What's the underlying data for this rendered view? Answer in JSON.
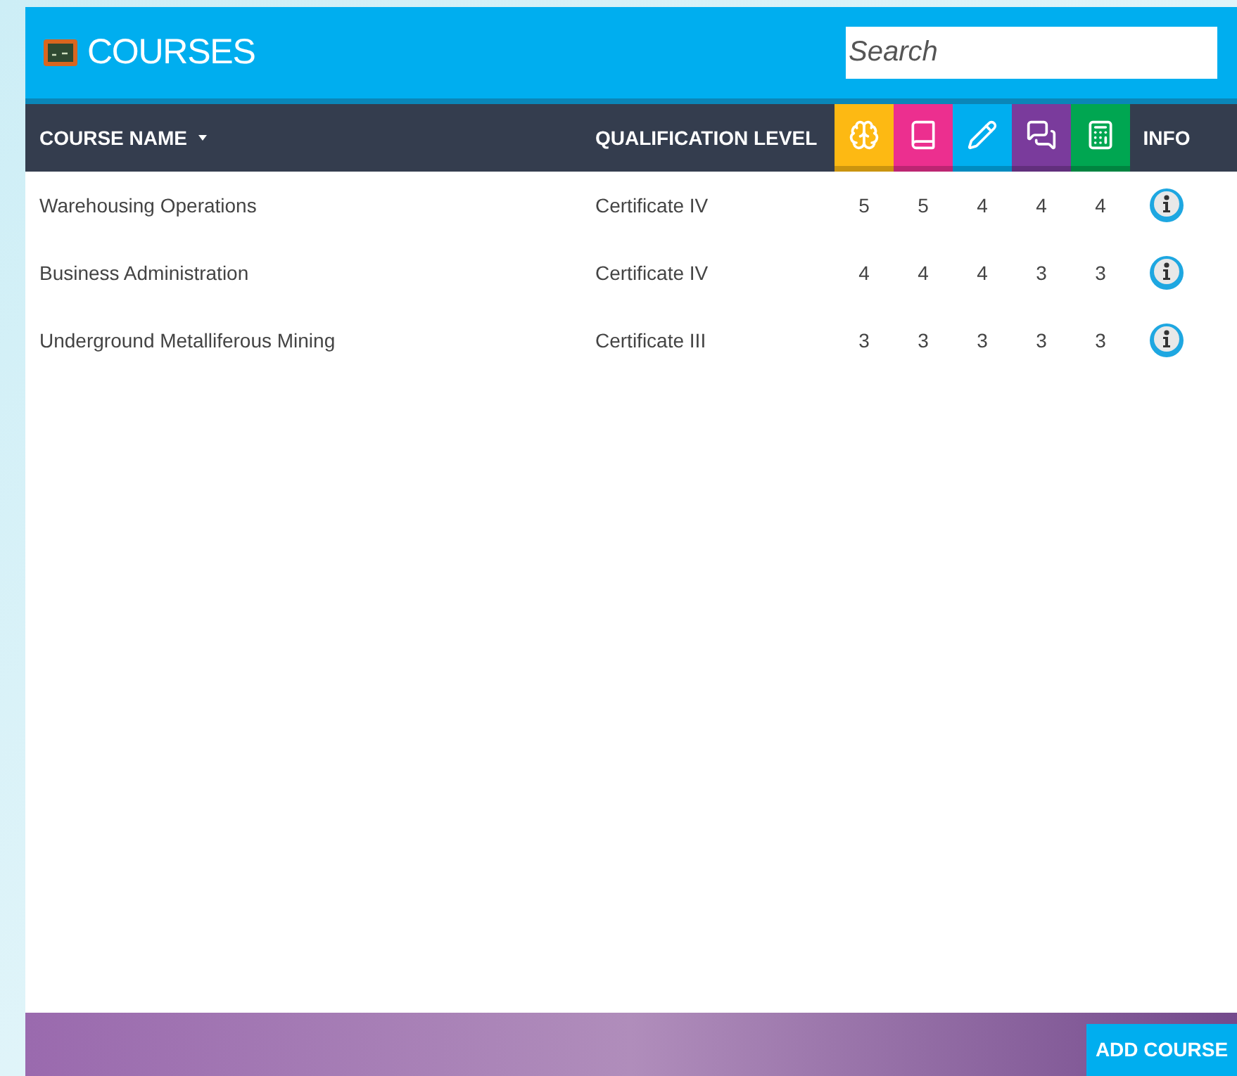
{
  "header": {
    "title": "COURSES",
    "search": {
      "placeholder": "Search"
    }
  },
  "table": {
    "columns": [
      {
        "label": "COURSE NAME",
        "sorted": true
      },
      {
        "label": "QUALIFICATION LEVEL",
        "sorted": false
      }
    ],
    "skill_columns": [
      {
        "color": "#fdb913"
      },
      {
        "color": "#ec2f8f"
      },
      {
        "color": "#00aeef"
      },
      {
        "color": "#7a3b9c"
      },
      {
        "color": "#00a651"
      }
    ],
    "info_column": "INFO",
    "rows": [
      {
        "name": "Warehousing Operations",
        "level": "Certificate IV",
        "scores": [
          "5",
          "5",
          "4",
          "4",
          "4"
        ]
      },
      {
        "name": "Business Administration",
        "level": "Certificate IV",
        "scores": [
          "4",
          "4",
          "4",
          "3",
          "3"
        ]
      },
      {
        "name": "Underground Metalliferous Mining",
        "level": "Certificate III",
        "scores": [
          "3",
          "3",
          "3",
          "3",
          "3"
        ]
      }
    ]
  },
  "footer": {
    "button": "ADD COURSE"
  }
}
